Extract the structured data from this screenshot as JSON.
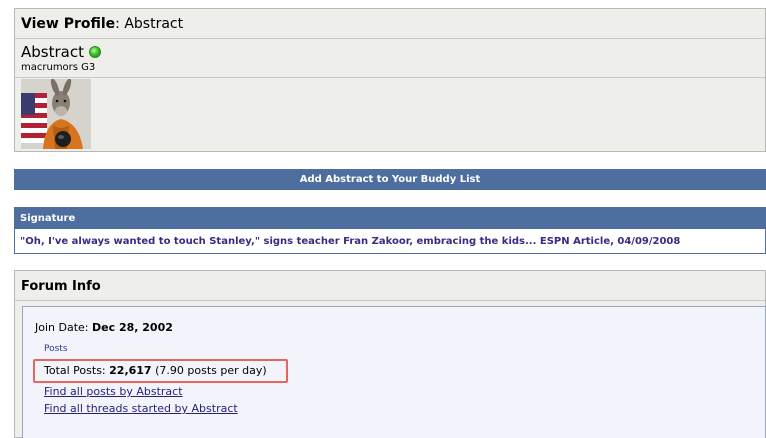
{
  "profile": {
    "header_label": "View Profile",
    "header_separator": ":",
    "header_name": "Abstract",
    "username": "Abstract",
    "online_status": "online",
    "user_title": "macrumors G3"
  },
  "buddy": {
    "label": "Add Abstract to Your Buddy List"
  },
  "signature": {
    "header": "Signature",
    "text": "\"Oh, I've always wanted to touch Stanley,\" signs teacher Fran Zakoor, embracing the kids... ESPN Article, 04/09/2008"
  },
  "forum_info": {
    "header": "Forum Info",
    "join_label": "Join Date:",
    "join_value": "Dec 28, 2002",
    "posts_label": "Posts",
    "total_label": "Total Posts:",
    "total_value": "22,617",
    "per_day": "(7.90 posts per day)",
    "link_all_posts": "Find all posts by Abstract",
    "link_all_threads": "Find all threads started by Abstract"
  },
  "colors": {
    "header_blue": "#4d6e9e",
    "panel_bg": "#eeeeea",
    "signature_text": "#3b2a83",
    "highlight_box": "#e4675c",
    "online_green": "#3cc42a"
  }
}
